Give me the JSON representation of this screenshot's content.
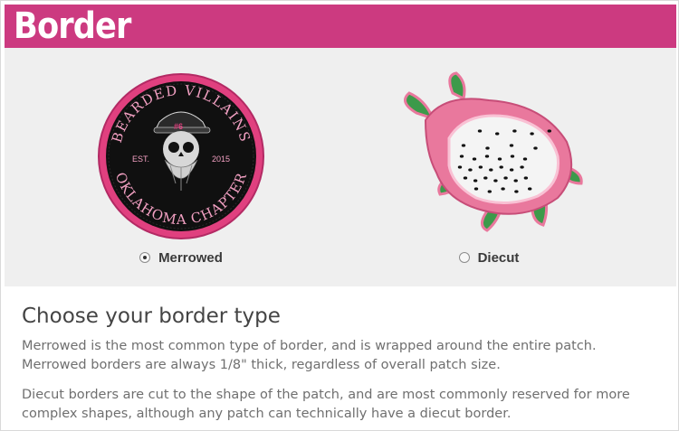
{
  "banner": {
    "title": "Border",
    "color": "#cc3a80"
  },
  "options": [
    {
      "label": "Merrowed",
      "selected": true,
      "patch": {
        "top_text": "BEARDED VILLAINS",
        "bottom_text": "OKLAHOMA CHAPTER",
        "left_text": "EST.",
        "right_text": "2015",
        "cap_text": "#6",
        "colors": {
          "border": "#e0407f",
          "fill": "#0e0e0e",
          "text": "#f2a0c2"
        }
      }
    },
    {
      "label": "Diecut",
      "selected": false,
      "patch": {
        "subject": "dragon fruit",
        "colors": {
          "skin": "#e9789d",
          "flesh": "#f4f4f4",
          "seeds": "#111111",
          "leaves": "#3c9a4a"
        }
      }
    }
  ],
  "content": {
    "heading": "Choose your border type",
    "paragraphs": [
      "Merrowed is the most common type of border, and is wrapped around the entire patch. Merrowed borders are always 1/8\" thick, regardless of overall patch size.",
      "Diecut borders are cut to the shape of the patch, and are most commonly reserved for more complex shapes, although any patch can technically have a diecut border."
    ]
  }
}
